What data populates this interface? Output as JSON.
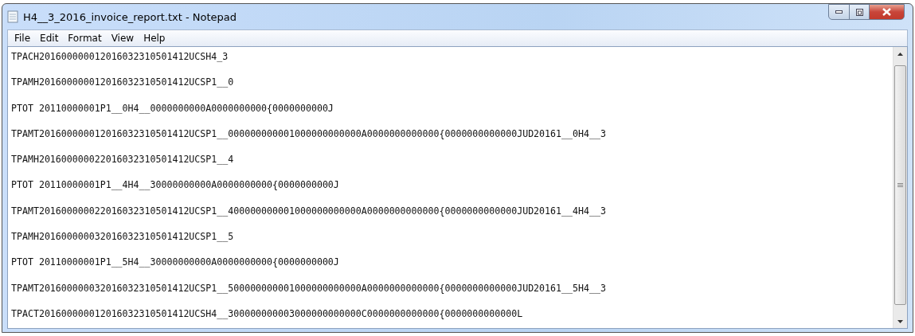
{
  "window": {
    "title": "H4__3_2016_invoice_report.txt - Notepad"
  },
  "menu": [
    "File",
    "Edit",
    "Format",
    "View",
    "Help"
  ],
  "lines": [
    "TPACH201600000012016032310501412UCSH4_3",
    "TPAMH201600000012016032310501412UCSP1__0",
    "PTOT 20110000001P1__0H4__0000000000A0000000000{0000000000J",
    "TPAMT201600000012016032310501412UCSP1__000000000001000000000000A0000000000000{0000000000000JUD20161__0H4__3",
    "TPAMH201600000022016032310501412UCSP1__4",
    "PTOT 20110000001P1__4H4__30000000000A0000000000{0000000000J",
    "TPAMT201600000022016032310501412UCSP1__400000000001000000000000A0000000000000{0000000000000JUD20161__4H4__3",
    "TPAMH201600000032016032310501412UCSP1__5",
    "PTOT 20110000001P1__5H4__30000000000A0000000000{0000000000J",
    "TPAMT201600000032016032310501412UCSP1__500000000001000000000000A0000000000000{0000000000000JUD20161__5H4__3",
    "TPACT201600000012016032310501412UCSH4__300000000003000000000000C0000000000000{0000000000000L"
  ]
}
